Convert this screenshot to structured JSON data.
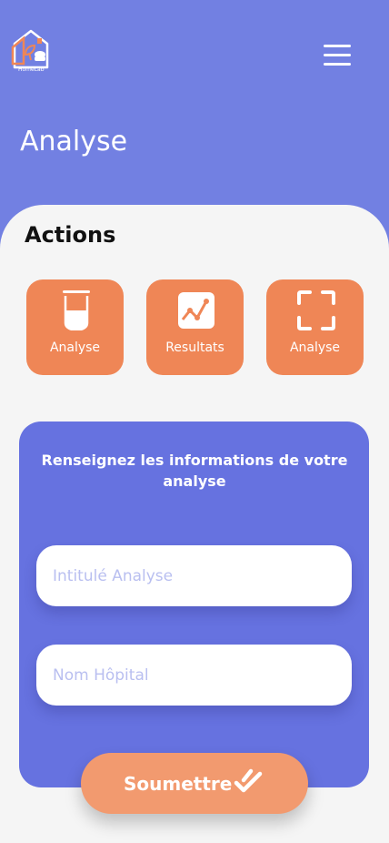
{
  "header": {
    "logo_text": "HomeLab",
    "title": "Analyse",
    "menu_icon": "hamburger-menu-icon"
  },
  "actions": {
    "title": "Actions",
    "items": [
      {
        "label": "Analyse",
        "icon": "test-tube-icon"
      },
      {
        "label": "Resultats",
        "icon": "chart-icon"
      },
      {
        "label": "Analyse",
        "icon": "scan-frame-icon"
      }
    ]
  },
  "form": {
    "heading": "Renseignez les informations de votre analyse",
    "fields": [
      {
        "placeholder": "Intitulé Analyse"
      },
      {
        "placeholder": "Nom Hôpital"
      }
    ],
    "submit_label": "Soumettre",
    "submit_icon": "double-check-icon"
  },
  "colors": {
    "header_bg": "#7280e2",
    "card_accent": "#ef8656",
    "form_bg": "#6672e0",
    "submit_bg": "#f29a6f"
  }
}
